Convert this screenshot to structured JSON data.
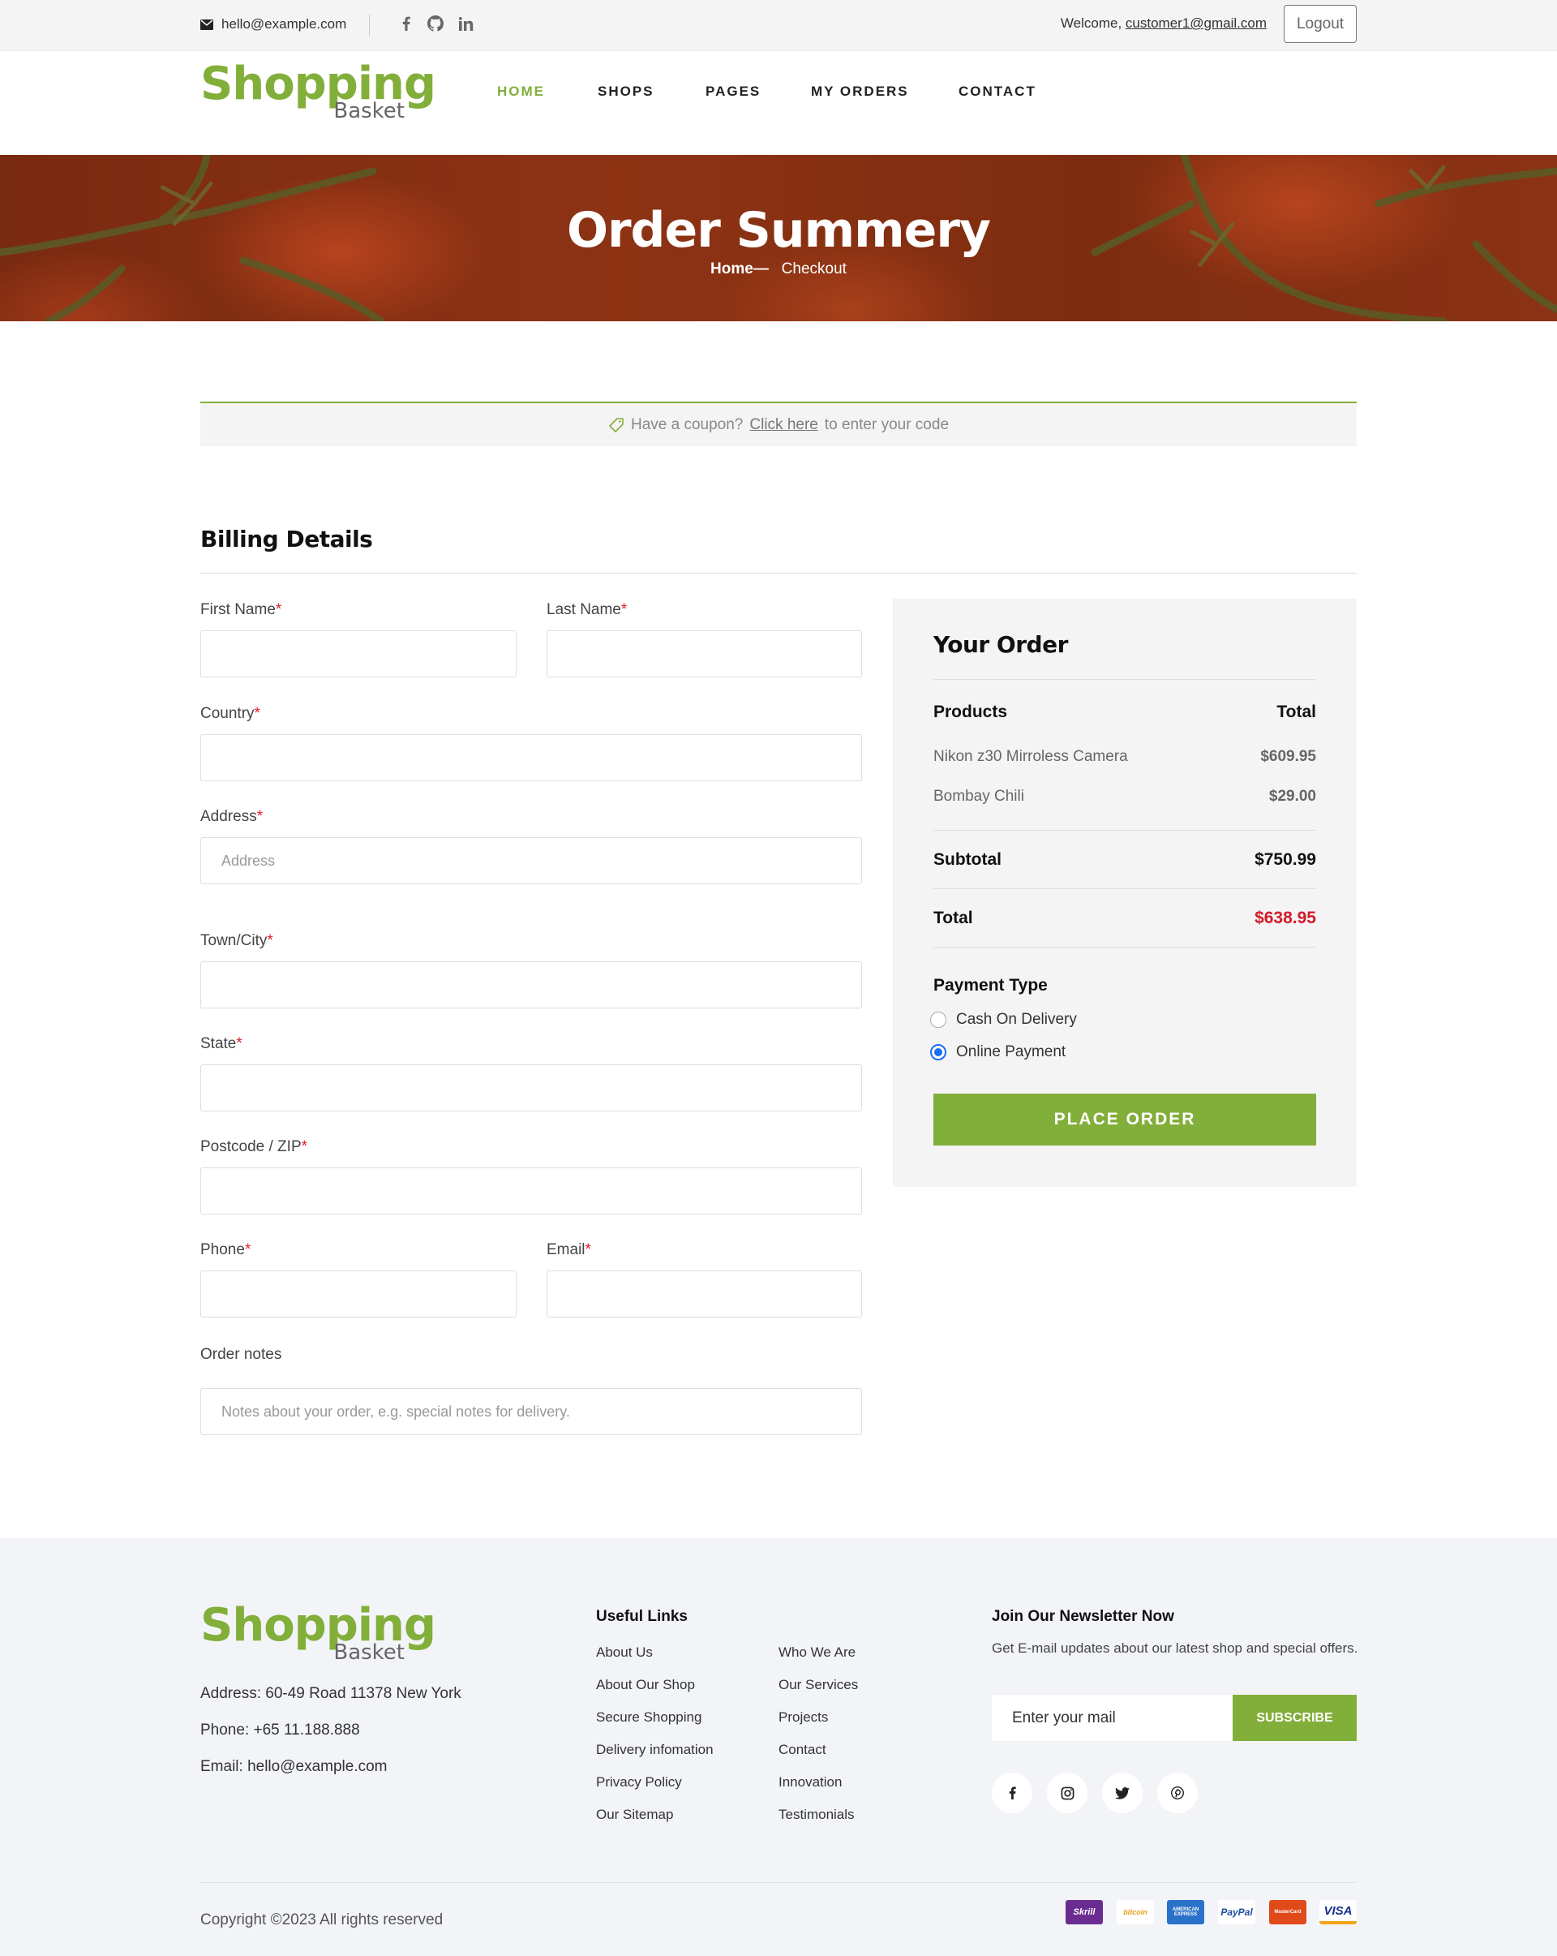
{
  "topbar": {
    "email": "hello@example.com",
    "welcome_prefix": "Welcome,",
    "user": "customer1@gmail.com",
    "logout": "Logout",
    "social_icons": [
      "facebook-icon",
      "github-icon",
      "linkedin-icon"
    ]
  },
  "brand": {
    "name": "Shopping",
    "sub": "Basket",
    "color": "#82ae3a"
  },
  "nav": [
    "HOME",
    "SHOPS",
    "PAGES",
    "MY ORDERS",
    "CONTACT"
  ],
  "banner": {
    "title": "Order Summery",
    "crumb_home": "Home—",
    "crumb_current": "Checkout"
  },
  "coupon": {
    "prefix": "Have a coupon?",
    "link": "Click here",
    "suffix": "to enter your code"
  },
  "billing": {
    "title": "Billing Details",
    "first_name": "First Name",
    "last_name": "Last Name",
    "country": "Country",
    "address": "Address",
    "address_placeholder": "Address",
    "town": "Town/City",
    "state": "State",
    "postcode": "Postcode / ZIP",
    "phone": "Phone",
    "email": "Email",
    "notes": "Order notes",
    "notes_placeholder": "Notes about your order, e.g. special notes for delivery.",
    "required_mark": "*"
  },
  "order": {
    "title": "Your Order",
    "col_products": "Products",
    "col_total": "Total",
    "items": [
      {
        "name": "Nikon z30 Mirroless Camera",
        "price": "$609.95"
      },
      {
        "name": "Bombay Chili",
        "price": "$29.00"
      }
    ],
    "subtotal_label": "Subtotal",
    "subtotal": "$750.99",
    "total_label": "Total",
    "total": "$638.95",
    "payment_title": "Payment Type",
    "payment_options": [
      "Cash On Delivery",
      "Online Payment"
    ],
    "payment_selected": "Online Payment",
    "place_order": "PLACE ORDER"
  },
  "footer": {
    "address": "Address: 60-49 Road 11378 New York",
    "phone": "Phone: +65 11.188.888",
    "email": "Email: hello@example.com",
    "links_title": "Useful Links",
    "links_col1": [
      "About Us",
      "About Our Shop",
      "Secure Shopping",
      "Delivery infomation",
      "Privacy Policy",
      "Our Sitemap"
    ],
    "links_col2": [
      "Who We Are",
      "Our Services",
      "Projects",
      "Contact",
      "Innovation",
      "Testimonials"
    ],
    "newsletter_title": "Join Our Newsletter Now",
    "newsletter_desc": "Get E-mail updates about our latest shop and special offers.",
    "newsletter_placeholder": "Enter your mail",
    "subscribe": "SUBSCRIBE",
    "social_icons": [
      "facebook-icon",
      "instagram-icon",
      "twitter-icon",
      "pinterest-icon"
    ],
    "copyright": "Copyright ©2023 All rights reserved",
    "payments": [
      "Skrill",
      "bitcoin",
      "AMERICAN EXPRESS",
      "PayPal",
      "MasterCard",
      "VISA"
    ]
  }
}
